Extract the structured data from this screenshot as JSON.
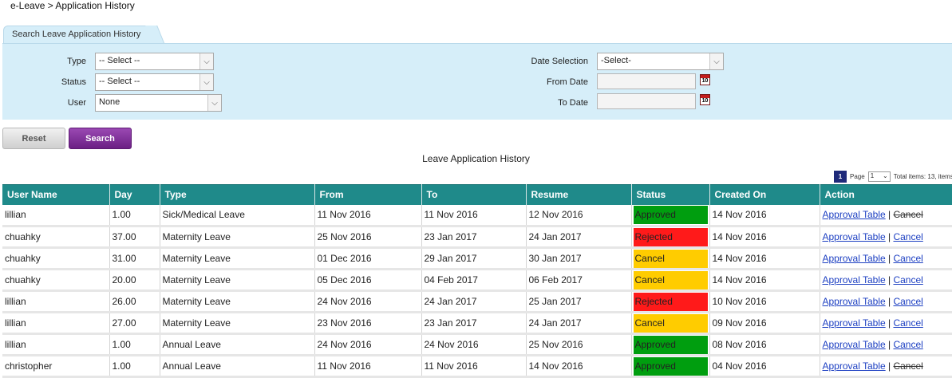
{
  "breadcrumb": "e-Leave > Application History",
  "search_tab": "Search Leave Application History",
  "filters": {
    "type_label": "Type",
    "type_value": "-- Select --",
    "status_label": "Status",
    "status_value": "-- Select --",
    "user_label": "User",
    "user_value": "None",
    "date_selection_label": "Date Selection",
    "date_selection_value": "-Select-",
    "from_date_label": "From Date",
    "to_date_label": "To Date",
    "calendar_icon_text": "10"
  },
  "buttons": {
    "reset": "Reset",
    "search": "Search"
  },
  "table_title": "Leave Application History",
  "pager": {
    "current": "1",
    "page_label": "Page",
    "page_value": "1",
    "total": "Total items: 13, items"
  },
  "columns": [
    "User Name",
    "Day",
    "Type",
    "From",
    "To",
    "Resume",
    "Status",
    "Created On",
    "Action"
  ],
  "colors": {
    "approved": "#009e0f",
    "rejected": "#ff1a1a",
    "cancel": "#ffcc00",
    "header": "#1f8a8a"
  },
  "rows": [
    {
      "user": "lillian",
      "day": "1.00",
      "type": "Sick/Medical Leave",
      "from": "11 Nov 2016",
      "to": "11 Nov 2016",
      "resume": "12 Nov 2016",
      "status": "Approved",
      "created": "14 Nov 2016",
      "action1": "Approval Table",
      "sep": " | ",
      "action2": "Cancel"
    },
    {
      "user": "chuahky",
      "day": "37.00",
      "type": "Maternity Leave",
      "from": "25 Nov 2016",
      "to": "23 Jan 2017",
      "resume": "24 Jan 2017",
      "status": "Rejected",
      "created": "14 Nov 2016",
      "action1": "Approval Table",
      "sep": " | ",
      "action2": "Cancel"
    },
    {
      "user": "chuahky",
      "day": "31.00",
      "type": "Maternity Leave",
      "from": "01 Dec 2016",
      "to": "29 Jan 2017",
      "resume": "30 Jan 2017",
      "status": "Cancel",
      "created": "14 Nov 2016",
      "action1": "Approval Table",
      "sep": " | ",
      "action2": "Cancel"
    },
    {
      "user": "chuahky",
      "day": "20.00",
      "type": "Maternity Leave",
      "from": "05 Dec 2016",
      "to": "04 Feb 2017",
      "resume": "06 Feb 2017",
      "status": "Cancel",
      "created": "14 Nov 2016",
      "action1": "Approval Table",
      "sep": " | ",
      "action2": "Cancel"
    },
    {
      "user": "lillian",
      "day": "26.00",
      "type": "Maternity Leave",
      "from": "24 Nov 2016",
      "to": "24 Jan 2017",
      "resume": "25 Jan 2017",
      "status": "Rejected",
      "created": "10 Nov 2016",
      "action1": "Approval Table",
      "sep": " | ",
      "action2": "Cancel"
    },
    {
      "user": "lillian",
      "day": "27.00",
      "type": "Maternity Leave",
      "from": "23 Nov 2016",
      "to": "23 Jan 2017",
      "resume": "24 Jan 2017",
      "status": "Cancel",
      "created": "09 Nov 2016",
      "action1": "Approval Table",
      "sep": " | ",
      "action2": "Cancel"
    },
    {
      "user": "lillian",
      "day": "1.00",
      "type": "Annual Leave",
      "from": "24 Nov 2016",
      "to": "24 Nov 2016",
      "resume": "25 Nov 2016",
      "status": "Approved",
      "created": "08 Nov 2016",
      "action1": "Approval Table",
      "sep": " | ",
      "action2": "Cancel"
    },
    {
      "user": "christopher",
      "day": "1.00",
      "type": "Annual Leave",
      "from": "11 Nov 2016",
      "to": "11 Nov 2016",
      "resume": "14 Nov 2016",
      "status": "Approved",
      "created": "04 Nov 2016",
      "action1": "Approval Table",
      "sep": " | ",
      "action2": "Cancel"
    }
  ]
}
